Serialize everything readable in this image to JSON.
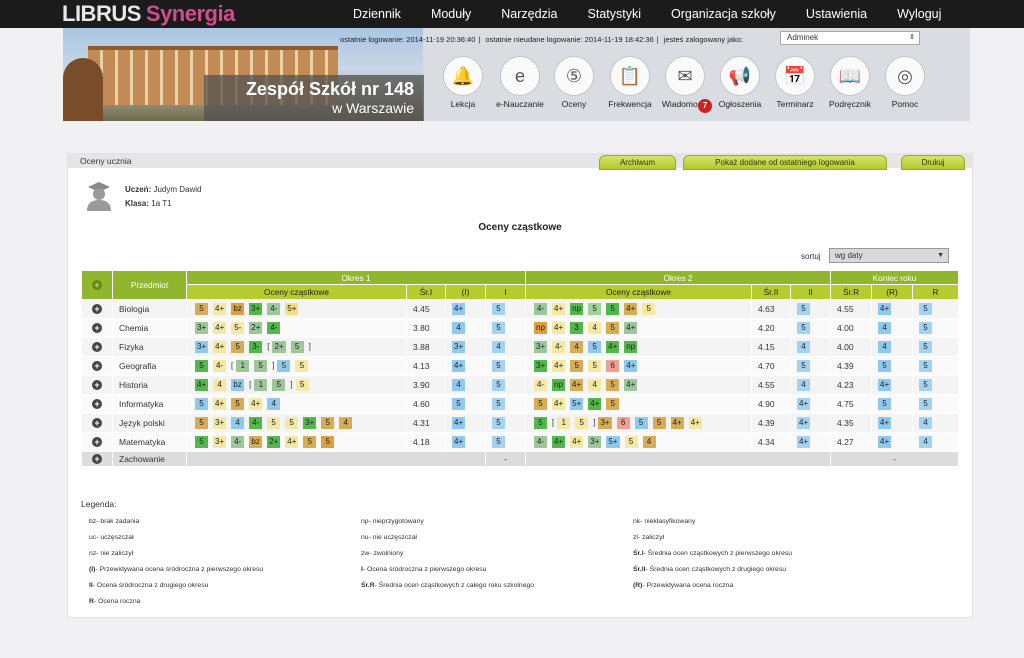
{
  "logo": {
    "part1": "LIBRUS",
    "part2": "Synergia"
  },
  "top_nav": [
    "Dziennik",
    "Moduły",
    "Narzędzia",
    "Statystyki",
    "Organizacja szkoły",
    "Ustawienia",
    "Wyloguj"
  ],
  "login_info": {
    "last_login": "ostatnie logowanie: 2014-11-19 20:36:40",
    "last_failed": "ostatnie nieudane logowanie: 2014-11-19 18:42:36",
    "logged_as_label": "jesteś zalogowany jako:",
    "role": "Adminek"
  },
  "school": {
    "line1": "Zespół Szkół nr 148",
    "line2": "w Warszawie"
  },
  "nav_icons": [
    {
      "label": "Lekcja",
      "icon": "bell-icon",
      "glyph": "🔔"
    },
    {
      "label": "e-Nauczanie",
      "icon": "e-learning-icon",
      "glyph": "e"
    },
    {
      "label": "Oceny",
      "icon": "grades-icon",
      "glyph": "⑤"
    },
    {
      "label": "Frekwencja",
      "icon": "attendance-icon",
      "glyph": "📋"
    },
    {
      "label": "Wiadomości",
      "icon": "envelope-icon",
      "glyph": "✉",
      "badge": "7"
    },
    {
      "label": "Ogłoszenia",
      "icon": "megaphone-icon",
      "glyph": "📢"
    },
    {
      "label": "Terminarz",
      "icon": "calendar-icon",
      "glyph": "📅"
    },
    {
      "label": "Podręcznik",
      "icon": "book-icon",
      "glyph": "📖"
    },
    {
      "label": "Pomoc",
      "icon": "lifebuoy-icon",
      "glyph": "◎"
    }
  ],
  "panel": {
    "title": "Oceny ucznia",
    "buttons": {
      "archive": "Archiwum",
      "show_new": "Pokaż dodane od ostatniego logowania",
      "print": "Drukuj"
    },
    "student_label": "Uczeń:",
    "student_name": "Judym Dawid",
    "class_label": "Klasa:",
    "class_name": "1a T1",
    "section_title": "Oceny cząstkowe",
    "sort_label": "sortuj",
    "sort_value": "wg daty"
  },
  "table": {
    "headers": {
      "subject": "Przedmiot",
      "period1": "Okres 1",
      "period2": "Okres 2",
      "year_end": "Koniec roku",
      "partial": "Oceny cząstkowe",
      "avg1": "Śr.I",
      "pred1": "(I)",
      "final1": "I",
      "avg2": "Śr.II",
      "final2": "II",
      "avgR": "Śr.R",
      "predR": "(R)",
      "finalR": "R"
    },
    "rows": [
      {
        "subject": "Biologia",
        "p1": [
          {
            "v": "5",
            "c": "#d6ad54"
          },
          {
            "v": "4+",
            "c": "#f3e9a3"
          },
          {
            "v": "bz",
            "c": "#dda03f"
          },
          {
            "v": "3+",
            "c": "#52b84c"
          },
          {
            "v": "4-",
            "c": "#9dc79a"
          },
          {
            "v": "5+",
            "c": "#f0e080"
          }
        ],
        "avg1": "4.45",
        "pred1": "4+",
        "fin1": "5",
        "p2": [
          {
            "v": "4-",
            "c": "#9dc79a"
          },
          {
            "v": "4+",
            "c": "#f3e9a3"
          },
          {
            "v": "np",
            "c": "#52b84c"
          },
          {
            "v": "5",
            "c": "#9ed29a"
          },
          {
            "v": "5",
            "c": "#52b84c"
          },
          {
            "v": "4+",
            "c": "#d6ad54"
          },
          {
            "v": "5",
            "c": "#f3e9a3"
          }
        ],
        "avg2": "4.63",
        "fin2": "5",
        "avgR": "4.55",
        "predR": "4+",
        "finR": "5"
      },
      {
        "subject": "Chemia",
        "p1": [
          {
            "v": "3+",
            "c": "#9dc79a"
          },
          {
            "v": "4+",
            "c": "#f3e9a3"
          },
          {
            "v": "5-",
            "c": "#f3e9a3"
          },
          {
            "v": "2+",
            "c": "#9dc79a"
          },
          {
            "v": "4-",
            "c": "#52b84c"
          }
        ],
        "avg1": "3.80",
        "pred1": "4",
        "fin1": "5",
        "p2": [
          {
            "v": "np",
            "c": "#dda03f"
          },
          {
            "v": "4+",
            "c": "#f3e9a3"
          },
          {
            "v": "3",
            "c": "#52b84c"
          },
          {
            "v": "4",
            "c": "#f3e9a3"
          },
          {
            "v": "5",
            "c": "#d6ad54"
          },
          {
            "v": "4+",
            "c": "#9dc79a"
          }
        ],
        "avg2": "4.20",
        "fin2": "5",
        "avgR": "4.00",
        "predR": "4",
        "finR": "5"
      },
      {
        "subject": "Fizyka",
        "p1": [
          {
            "v": "3+",
            "c": "#90c9ef"
          },
          {
            "v": "4+",
            "c": "#f3e9a3"
          },
          {
            "v": "5",
            "c": "#d6ad54"
          },
          {
            "v": "3-",
            "c": "#52b84c"
          },
          {
            "v": "[",
            "c": ""
          },
          {
            "v": "2+",
            "c": "#9dc79a"
          },
          {
            "v": "5",
            "c": "#9dc79a"
          },
          {
            "v": "]",
            "c": ""
          }
        ],
        "avg1": "3.88",
        "pred1": "3+",
        "fin1": "4",
        "p2": [
          {
            "v": "3+",
            "c": "#9dc79a"
          },
          {
            "v": "4-",
            "c": "#f3e9a3"
          },
          {
            "v": "4",
            "c": "#d6ad54"
          },
          {
            "v": "5",
            "c": "#90c9ef"
          },
          {
            "v": "4+",
            "c": "#52b84c"
          },
          {
            "v": "np",
            "c": "#52b84c"
          }
        ],
        "avg2": "4.15",
        "fin2": "4",
        "avgR": "4.00",
        "predR": "4",
        "finR": "5"
      },
      {
        "subject": "Geografia",
        "p1": [
          {
            "v": "5",
            "c": "#52b84c"
          },
          {
            "v": "4-",
            "c": "#f3e9a3"
          },
          {
            "v": "[",
            "c": ""
          },
          {
            "v": "1",
            "c": "#9dc79a"
          },
          {
            "v": "5",
            "c": "#9dc79a"
          },
          {
            "v": "]",
            "c": ""
          },
          {
            "v": "5",
            "c": "#90c9ef"
          },
          {
            "v": "5",
            "c": "#f3e9a3"
          }
        ],
        "avg1": "4.13",
        "pred1": "4+",
        "fin1": "5",
        "p2": [
          {
            "v": "3+",
            "c": "#52b84c"
          },
          {
            "v": "4+",
            "c": "#f3e9a3"
          },
          {
            "v": "5",
            "c": "#d6ad54"
          },
          {
            "v": "5",
            "c": "#f3e9a3"
          },
          {
            "v": "6",
            "c": "#f0a090"
          },
          {
            "v": "4+",
            "c": "#90c9ef"
          }
        ],
        "avg2": "4.70",
        "fin2": "5",
        "avgR": "4.39",
        "predR": "5",
        "finR": "5"
      },
      {
        "subject": "Historia",
        "p1": [
          {
            "v": "4+",
            "c": "#52b84c"
          },
          {
            "v": "4",
            "c": "#f3e9a3"
          },
          {
            "v": "bz",
            "c": "#90c9ef"
          },
          {
            "v": "[",
            "c": ""
          },
          {
            "v": "1",
            "c": "#9dc79a"
          },
          {
            "v": "5",
            "c": "#9dc79a"
          },
          {
            "v": "]",
            "c": ""
          },
          {
            "v": "5",
            "c": "#f3e9a3"
          }
        ],
        "avg1": "3.90",
        "pred1": "4",
        "fin1": "5",
        "p2": [
          {
            "v": "4-",
            "c": "#f3e9a3"
          },
          {
            "v": "np",
            "c": "#52b84c"
          },
          {
            "v": "4+",
            "c": "#d6ad54"
          },
          {
            "v": "4",
            "c": "#f3e9a3"
          },
          {
            "v": "5",
            "c": "#d6ad54"
          },
          {
            "v": "4+",
            "c": "#9dc79a"
          }
        ],
        "avg2": "4.55",
        "fin2": "4",
        "avgR": "4.23",
        "predR": "4+",
        "finR": "5"
      },
      {
        "subject": "Informatyka",
        "p1": [
          {
            "v": "5",
            "c": "#90c9ef"
          },
          {
            "v": "4+",
            "c": "#f3e9a3"
          },
          {
            "v": "5",
            "c": "#d6ad54"
          },
          {
            "v": "4+",
            "c": "#f3e9a3"
          },
          {
            "v": "4",
            "c": "#90c9ef"
          }
        ],
        "avg1": "4.60",
        "pred1": "5",
        "fin1": "5",
        "p2": [
          {
            "v": "5",
            "c": "#d6ad54"
          },
          {
            "v": "4+",
            "c": "#f3e9a3"
          },
          {
            "v": "5+",
            "c": "#90c9ef"
          },
          {
            "v": "4+",
            "c": "#52b84c"
          },
          {
            "v": "5",
            "c": "#d6ad54"
          }
        ],
        "avg2": "4.90",
        "fin2": "4+",
        "avgR": "4.75",
        "predR": "5",
        "finR": "5"
      },
      {
        "subject": "Język polski",
        "p1": [
          {
            "v": "5",
            "c": "#d6ad54"
          },
          {
            "v": "3+",
            "c": "#f3e9a3"
          },
          {
            "v": "4",
            "c": "#90c9ef"
          },
          {
            "v": "4-",
            "c": "#52b84c"
          },
          {
            "v": "5",
            "c": "#f3e9a3"
          },
          {
            "v": "5",
            "c": "#f3e9a3"
          },
          {
            "v": "3+",
            "c": "#52b84c"
          },
          {
            "v": "5",
            "c": "#d6ad54"
          },
          {
            "v": "4",
            "c": "#d6ad54"
          }
        ],
        "avg1": "4.31",
        "pred1": "4+",
        "fin1": "5",
        "p2": [
          {
            "v": "5",
            "c": "#52b84c"
          },
          {
            "v": "[",
            "c": ""
          },
          {
            "v": "1",
            "c": "#f3e9a3"
          },
          {
            "v": "5",
            "c": "#f3e9a3"
          },
          {
            "v": "]",
            "c": ""
          },
          {
            "v": "3+",
            "c": "#d6ad54"
          },
          {
            "v": "6",
            "c": "#f0a090"
          },
          {
            "v": "5",
            "c": "#90c9ef"
          },
          {
            "v": "5",
            "c": "#d6ad54"
          },
          {
            "v": "4+",
            "c": "#d6ad54"
          },
          {
            "v": "4+",
            "c": "#f3e9a3"
          }
        ],
        "avg2": "4.39",
        "fin2": "4+",
        "avgR": "4.35",
        "predR": "4+",
        "finR": "4"
      },
      {
        "subject": "Matematyka",
        "p1": [
          {
            "v": "5",
            "c": "#52b84c"
          },
          {
            "v": "3+",
            "c": "#f3e9a3"
          },
          {
            "v": "4-",
            "c": "#9dc79a"
          },
          {
            "v": "bz",
            "c": "#d6ad54"
          },
          {
            "v": "2+",
            "c": "#52b84c"
          },
          {
            "v": "4+",
            "c": "#f3e9a3"
          },
          {
            "v": "5",
            "c": "#d6ad54"
          },
          {
            "v": "5",
            "c": "#dda03f"
          }
        ],
        "avg1": "4.18",
        "pred1": "4+",
        "fin1": "5",
        "p2": [
          {
            "v": "4-",
            "c": "#9dc79a"
          },
          {
            "v": "4+",
            "c": "#52b84c"
          },
          {
            "v": "4+",
            "c": "#f3e9a3"
          },
          {
            "v": "3+",
            "c": "#9dc79a"
          },
          {
            "v": "5+",
            "c": "#90c9ef"
          },
          {
            "v": "5",
            "c": "#f3e9a3"
          },
          {
            "v": "4",
            "c": "#d6ad54"
          }
        ],
        "avg2": "4.34",
        "fin2": "4+",
        "avgR": "4.27",
        "predR": "4+",
        "finR": "4"
      }
    ],
    "behavior": {
      "subject": "Zachowanie",
      "fin1": "-",
      "finR": "-"
    }
  },
  "legend": {
    "title": "Legenda:",
    "items": [
      {
        "k": "bz",
        "t": "- brak zadania"
      },
      {
        "k": "np",
        "t": "- nieprzygotowany"
      },
      {
        "k": "nk",
        "t": "- niekłasyfikowany"
      },
      {
        "k": "uc",
        "t": "- uczęszczał"
      },
      {
        "k": "nu",
        "t": "- nie uczęszczał"
      },
      {
        "k": "zl",
        "t": "- zaliczył"
      },
      {
        "k": "nz",
        "t": "- nie zaliczył"
      },
      {
        "k": "zw",
        "t": "- zwolniony"
      },
      {
        "k": "Śr.I",
        "t": "- Średnia ocen cząstkowych z pierwszego okresu"
      },
      {
        "k": "(I)",
        "t": "- Przewidywana ocena śródroczna z pierwszego okresu"
      },
      {
        "k": "I",
        "t": "- Ocena śródroczna z pierwszego okresu"
      },
      {
        "k": "Śr.II",
        "t": "- Średnia ocen cząstkowych z drugiego okresu"
      },
      {
        "k": "II",
        "t": "- Ocena śródroczna z drugiego okresu"
      },
      {
        "k": "Śr.R",
        "t": "- Średnia ocen cząstkowych z całego roku szkolnego"
      },
      {
        "k": "(R)",
        "t": "- Przewidywana ocena roczna"
      },
      {
        "k": "R",
        "t": "- Ocena roczna"
      }
    ]
  }
}
